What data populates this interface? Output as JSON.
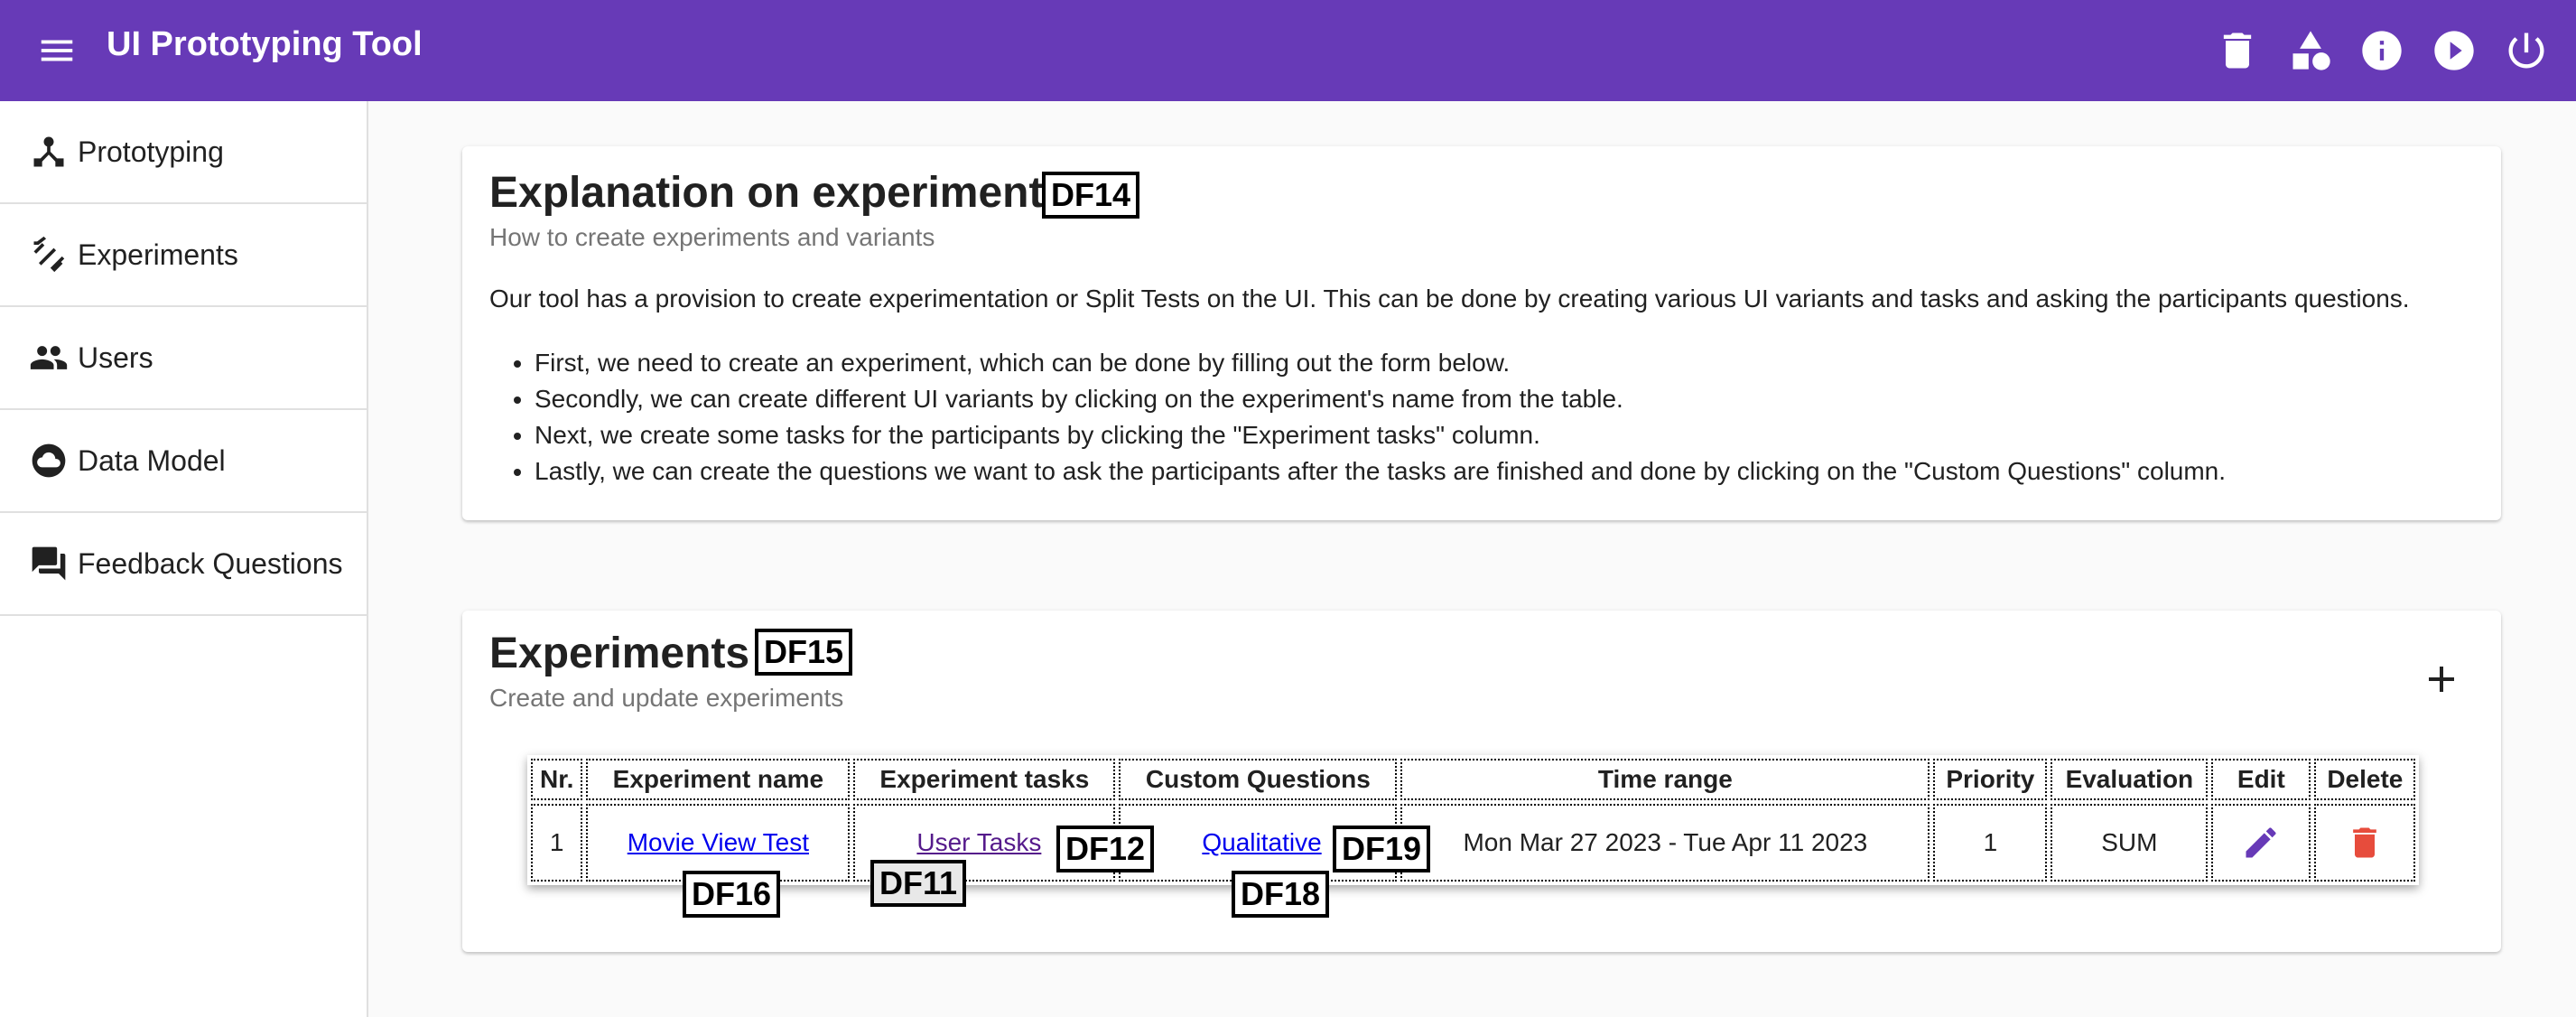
{
  "app": {
    "title": "UI Prototyping Tool",
    "brand_color": "#673ab7"
  },
  "toolbar": {
    "icons": [
      "menu-icon",
      "trash-icon",
      "shapes-icon",
      "info-icon",
      "play-icon",
      "power-icon"
    ]
  },
  "sidebar": {
    "items": [
      {
        "label": "Prototyping",
        "icon": "hub-icon"
      },
      {
        "label": "Experiments",
        "icon": "signal-icon"
      },
      {
        "label": "Users",
        "icon": "people-icon"
      },
      {
        "label": "Data Model",
        "icon": "cloud-icon"
      },
      {
        "label": "Feedback Questions",
        "icon": "forum-icon"
      }
    ]
  },
  "explanation": {
    "title": "Explanation on experiments",
    "tag": "DF14",
    "subtitle": "How to create experiments and variants",
    "intro": "Our tool has a provision to create experimentation or Split Tests on the UI. This can be done by creating various UI variants and tasks and asking the participants questions.",
    "bullets": [
      "First, we need to create an experiment, which can be done by filling out the form below.",
      "Secondly, we can create different UI variants by clicking on the experiment's name from the table.",
      "Next, we create some tasks for the participants by clicking the \"Experiment tasks\" column.",
      "Lastly, we can create the questions we want to ask the participants after the tasks are finished and done by clicking on the \"Custom Questions\" column."
    ]
  },
  "experiments": {
    "title": "Experiments",
    "tag": "DF15",
    "subtitle": "Create and update experiments",
    "columns": [
      "Nr.",
      "Experiment name",
      "Experiment tasks",
      "Custom Questions",
      "Time range",
      "Priority",
      "Evaluation",
      "Edit",
      "Delete"
    ],
    "rows": [
      {
        "nr": "1",
        "name": "Movie View Test",
        "tasks": "User Tasks",
        "questions": "Qualitative",
        "time_range": "Mon Mar 27 2023 - Tue Apr 11 2023",
        "priority": "1",
        "evaluation": "SUM"
      }
    ],
    "tags": {
      "name": "DF16",
      "tasks_a": "DF11",
      "tasks_b": "DF12",
      "questions_a": "DF18",
      "questions_b": "DF19"
    },
    "edit_color": "#673ab7",
    "delete_color": "#e74c3c"
  }
}
